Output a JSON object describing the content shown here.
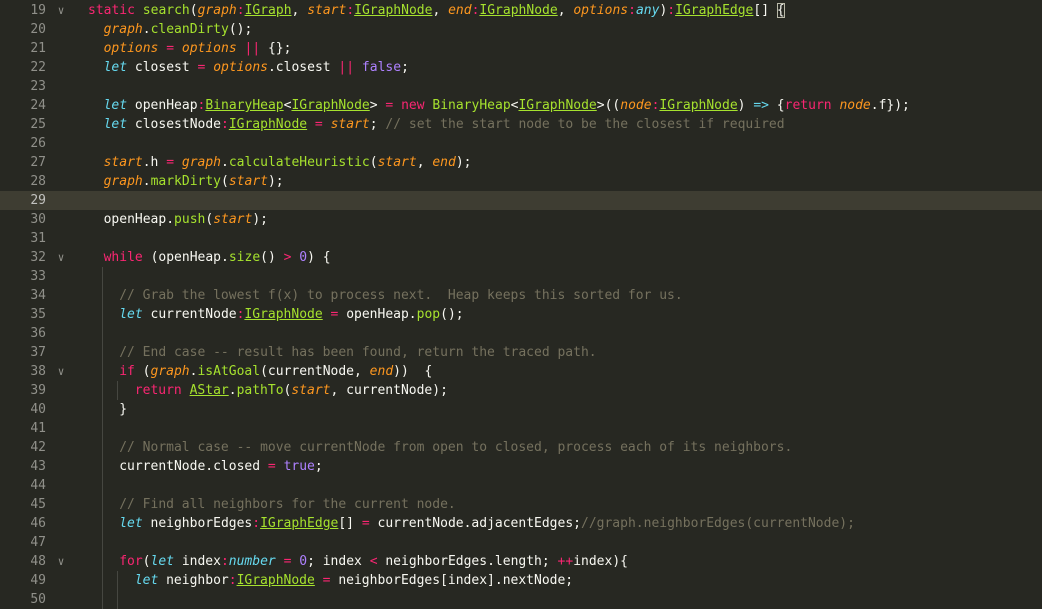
{
  "editor": {
    "theme_colors": {
      "background": "#272822",
      "current_line": "#3e3d32",
      "keyword": "#f92672",
      "function": "#a6e22e",
      "parameter": "#fd971f",
      "storage": "#66d9ef",
      "number": "#ae81ff",
      "comment": "#75715e"
    },
    "current_line_number": "29",
    "lines": [
      {
        "n": "19",
        "fold": true,
        "indent": 0,
        "tokens": [
          {
            "t": "static ",
            "c": "kw"
          },
          {
            "t": "search",
            "c": "fn"
          },
          {
            "t": "(",
            "c": "pl"
          },
          {
            "t": "graph",
            "c": "it"
          },
          {
            "t": ":",
            "c": "kw"
          },
          {
            "t": "IGraph",
            "c": "ty"
          },
          {
            "t": ", ",
            "c": "pl"
          },
          {
            "t": "start",
            "c": "it"
          },
          {
            "t": ":",
            "c": "kw"
          },
          {
            "t": "IGraphNode",
            "c": "ty"
          },
          {
            "t": ", ",
            "c": "pl"
          },
          {
            "t": "end",
            "c": "it"
          },
          {
            "t": ":",
            "c": "kw"
          },
          {
            "t": "IGraphNode",
            "c": "ty"
          },
          {
            "t": ", ",
            "c": "pl"
          },
          {
            "t": "options",
            "c": "it"
          },
          {
            "t": ":",
            "c": "kw"
          },
          {
            "t": "any",
            "c": "ltype"
          },
          {
            "t": ")",
            "c": "pl"
          },
          {
            "t": ":",
            "c": "kw"
          },
          {
            "t": "IGraphEdge",
            "c": "ty"
          },
          {
            "t": "[] ",
            "c": "pl"
          },
          {
            "t": "{",
            "c": "pl",
            "b": true
          }
        ]
      },
      {
        "n": "20",
        "fold": false,
        "indent": 1,
        "tokens": [
          {
            "t": "graph",
            "c": "it"
          },
          {
            "t": ".",
            "c": "pl"
          },
          {
            "t": "cleanDirty",
            "c": "fn"
          },
          {
            "t": "();",
            "c": "pl"
          }
        ]
      },
      {
        "n": "21",
        "fold": false,
        "indent": 1,
        "tokens": [
          {
            "t": "options",
            "c": "it"
          },
          {
            "t": " = ",
            "c": "kw"
          },
          {
            "t": "options",
            "c": "it"
          },
          {
            "t": " || ",
            "c": "kw"
          },
          {
            "t": "{};",
            "c": "pl"
          }
        ]
      },
      {
        "n": "22",
        "fold": false,
        "indent": 1,
        "tokens": [
          {
            "t": "let ",
            "c": "ltype"
          },
          {
            "t": "closest",
            "c": "pl"
          },
          {
            "t": " = ",
            "c": "kw"
          },
          {
            "t": "options",
            "c": "it"
          },
          {
            "t": ".closest",
            "c": "pl"
          },
          {
            "t": " || ",
            "c": "kw"
          },
          {
            "t": "false",
            "c": "num"
          },
          {
            "t": ";",
            "c": "pl"
          }
        ]
      },
      {
        "n": "23",
        "fold": false,
        "indent": 1,
        "tokens": []
      },
      {
        "n": "24",
        "fold": false,
        "indent": 1,
        "tokens": [
          {
            "t": "let ",
            "c": "ltype"
          },
          {
            "t": "openHeap",
            "c": "pl"
          },
          {
            "t": ":",
            "c": "kw"
          },
          {
            "t": "BinaryHeap",
            "c": "ty"
          },
          {
            "t": "<",
            "c": "pl"
          },
          {
            "t": "IGraphNode",
            "c": "ty"
          },
          {
            "t": ">",
            "c": "pl"
          },
          {
            "t": " = ",
            "c": "kw"
          },
          {
            "t": "new ",
            "c": "kw"
          },
          {
            "t": "BinaryHeap",
            "c": "fn"
          },
          {
            "t": "<",
            "c": "pl"
          },
          {
            "t": "IGraphNode",
            "c": "ty"
          },
          {
            "t": ">((",
            "c": "pl"
          },
          {
            "t": "node",
            "c": "it"
          },
          {
            "t": ":",
            "c": "kw"
          },
          {
            "t": "IGraphNode",
            "c": "ty"
          },
          {
            "t": ") ",
            "c": "pl"
          },
          {
            "t": "=>",
            "c": "sk"
          },
          {
            "t": " {",
            "c": "pl"
          },
          {
            "t": "return ",
            "c": "kw"
          },
          {
            "t": "node",
            "c": "it"
          },
          {
            "t": ".f});",
            "c": "pl"
          }
        ]
      },
      {
        "n": "25",
        "fold": false,
        "indent": 1,
        "tokens": [
          {
            "t": "let ",
            "c": "ltype"
          },
          {
            "t": "closestNode",
            "c": "pl"
          },
          {
            "t": ":",
            "c": "kw"
          },
          {
            "t": "IGraphNode",
            "c": "ty"
          },
          {
            "t": " = ",
            "c": "kw"
          },
          {
            "t": "start",
            "c": "it"
          },
          {
            "t": "; ",
            "c": "pl"
          },
          {
            "t": "// set the start node to be the closest if required",
            "c": "cmt"
          }
        ]
      },
      {
        "n": "26",
        "fold": false,
        "indent": 1,
        "tokens": []
      },
      {
        "n": "27",
        "fold": false,
        "indent": 1,
        "tokens": [
          {
            "t": "start",
            "c": "it"
          },
          {
            "t": ".h",
            "c": "pl"
          },
          {
            "t": " = ",
            "c": "kw"
          },
          {
            "t": "graph",
            "c": "it"
          },
          {
            "t": ".",
            "c": "pl"
          },
          {
            "t": "calculateHeuristic",
            "c": "fn"
          },
          {
            "t": "(",
            "c": "pl"
          },
          {
            "t": "start",
            "c": "it"
          },
          {
            "t": ", ",
            "c": "pl"
          },
          {
            "t": "end",
            "c": "it"
          },
          {
            "t": ");",
            "c": "pl"
          }
        ]
      },
      {
        "n": "28",
        "fold": false,
        "indent": 1,
        "tokens": [
          {
            "t": "graph",
            "c": "it"
          },
          {
            "t": ".",
            "c": "pl"
          },
          {
            "t": "markDirty",
            "c": "fn"
          },
          {
            "t": "(",
            "c": "pl"
          },
          {
            "t": "start",
            "c": "it"
          },
          {
            "t": ");",
            "c": "pl"
          }
        ]
      },
      {
        "n": "29",
        "fold": false,
        "indent": 1,
        "tokens": []
      },
      {
        "n": "30",
        "fold": false,
        "indent": 1,
        "tokens": [
          {
            "t": "openHeap",
            "c": "pl"
          },
          {
            "t": ".",
            "c": "pl"
          },
          {
            "t": "push",
            "c": "fn"
          },
          {
            "t": "(",
            "c": "pl"
          },
          {
            "t": "start",
            "c": "it"
          },
          {
            "t": ");",
            "c": "pl"
          }
        ]
      },
      {
        "n": "31",
        "fold": false,
        "indent": 1,
        "tokens": []
      },
      {
        "n": "32",
        "fold": true,
        "indent": 1,
        "tokens": [
          {
            "t": "while ",
            "c": "kw"
          },
          {
            "t": "(openHeap.",
            "c": "pl"
          },
          {
            "t": "size",
            "c": "fn"
          },
          {
            "t": "() ",
            "c": "pl"
          },
          {
            "t": ">",
            "c": "kw"
          },
          {
            "t": " ",
            "c": "pl"
          },
          {
            "t": "0",
            "c": "num"
          },
          {
            "t": ") {",
            "c": "pl"
          }
        ]
      },
      {
        "n": "33",
        "fold": false,
        "indent": 2,
        "tokens": []
      },
      {
        "n": "34",
        "fold": false,
        "indent": 2,
        "tokens": [
          {
            "t": "// Grab the lowest f(x) to process next.  Heap keeps this sorted for us.",
            "c": "cmt"
          }
        ]
      },
      {
        "n": "35",
        "fold": false,
        "indent": 2,
        "tokens": [
          {
            "t": "let ",
            "c": "ltype"
          },
          {
            "t": "currentNode",
            "c": "pl"
          },
          {
            "t": ":",
            "c": "kw"
          },
          {
            "t": "IGraphNode",
            "c": "ty"
          },
          {
            "t": " = ",
            "c": "kw"
          },
          {
            "t": "openHeap.",
            "c": "pl"
          },
          {
            "t": "pop",
            "c": "fn"
          },
          {
            "t": "();",
            "c": "pl"
          }
        ]
      },
      {
        "n": "36",
        "fold": false,
        "indent": 2,
        "tokens": []
      },
      {
        "n": "37",
        "fold": false,
        "indent": 2,
        "tokens": [
          {
            "t": "// End case -- result has been found, return the traced path.",
            "c": "cmt"
          }
        ]
      },
      {
        "n": "38",
        "fold": true,
        "indent": 2,
        "tokens": [
          {
            "t": "if ",
            "c": "kw"
          },
          {
            "t": "(",
            "c": "pl"
          },
          {
            "t": "graph",
            "c": "it"
          },
          {
            "t": ".",
            "c": "pl"
          },
          {
            "t": "isAtGoal",
            "c": "fn"
          },
          {
            "t": "(currentNode, ",
            "c": "pl"
          },
          {
            "t": "end",
            "c": "it"
          },
          {
            "t": "))  {",
            "c": "pl"
          }
        ]
      },
      {
        "n": "39",
        "fold": false,
        "indent": 3,
        "tokens": [
          {
            "t": "return ",
            "c": "kw"
          },
          {
            "t": "AStar",
            "c": "ty"
          },
          {
            "t": ".",
            "c": "pl"
          },
          {
            "t": "pathTo",
            "c": "fn"
          },
          {
            "t": "(",
            "c": "pl"
          },
          {
            "t": "start",
            "c": "it"
          },
          {
            "t": ", currentNode);",
            "c": "pl"
          }
        ]
      },
      {
        "n": "40",
        "fold": false,
        "indent": 2,
        "tokens": [
          {
            "t": "}",
            "c": "pl"
          }
        ]
      },
      {
        "n": "41",
        "fold": false,
        "indent": 2,
        "tokens": []
      },
      {
        "n": "42",
        "fold": false,
        "indent": 2,
        "tokens": [
          {
            "t": "// Normal case -- move currentNode from open to closed, process each of its neighbors.",
            "c": "cmt"
          }
        ]
      },
      {
        "n": "43",
        "fold": false,
        "indent": 2,
        "tokens": [
          {
            "t": "currentNode.closed",
            "c": "pl"
          },
          {
            "t": " = ",
            "c": "kw"
          },
          {
            "t": "true",
            "c": "num"
          },
          {
            "t": ";",
            "c": "pl"
          }
        ]
      },
      {
        "n": "44",
        "fold": false,
        "indent": 2,
        "tokens": []
      },
      {
        "n": "45",
        "fold": false,
        "indent": 2,
        "tokens": [
          {
            "t": "// Find all neighbors for the current node.",
            "c": "cmt"
          }
        ]
      },
      {
        "n": "46",
        "fold": false,
        "indent": 2,
        "tokens": [
          {
            "t": "let ",
            "c": "ltype"
          },
          {
            "t": "neighborEdges",
            "c": "pl"
          },
          {
            "t": ":",
            "c": "kw"
          },
          {
            "t": "IGraphEdge",
            "c": "ty"
          },
          {
            "t": "[]",
            "c": "pl"
          },
          {
            "t": " = ",
            "c": "kw"
          },
          {
            "t": "currentNode.adjacentEdges;",
            "c": "pl"
          },
          {
            "t": "//graph.neighborEdges(currentNode);",
            "c": "cmt"
          }
        ]
      },
      {
        "n": "47",
        "fold": false,
        "indent": 2,
        "tokens": []
      },
      {
        "n": "48",
        "fold": true,
        "indent": 2,
        "tokens": [
          {
            "t": "for",
            "c": "kw"
          },
          {
            "t": "(",
            "c": "pl"
          },
          {
            "t": "let ",
            "c": "ltype"
          },
          {
            "t": "index",
            "c": "pl"
          },
          {
            "t": ":",
            "c": "kw"
          },
          {
            "t": "number",
            "c": "ltype"
          },
          {
            "t": " = ",
            "c": "kw"
          },
          {
            "t": "0",
            "c": "num"
          },
          {
            "t": "; index ",
            "c": "pl"
          },
          {
            "t": "<",
            "c": "kw"
          },
          {
            "t": " neighborEdges.length; ",
            "c": "pl"
          },
          {
            "t": "++",
            "c": "kw"
          },
          {
            "t": "index){",
            "c": "pl"
          }
        ]
      },
      {
        "n": "49",
        "fold": false,
        "indent": 3,
        "tokens": [
          {
            "t": "let ",
            "c": "ltype"
          },
          {
            "t": "neighbor",
            "c": "pl"
          },
          {
            "t": ":",
            "c": "kw"
          },
          {
            "t": "IGraphNode",
            "c": "ty"
          },
          {
            "t": " = ",
            "c": "kw"
          },
          {
            "t": "neighborEdges[index].nextNode;",
            "c": "pl"
          }
        ]
      },
      {
        "n": "50",
        "fold": false,
        "indent": 3,
        "tokens": []
      }
    ]
  }
}
